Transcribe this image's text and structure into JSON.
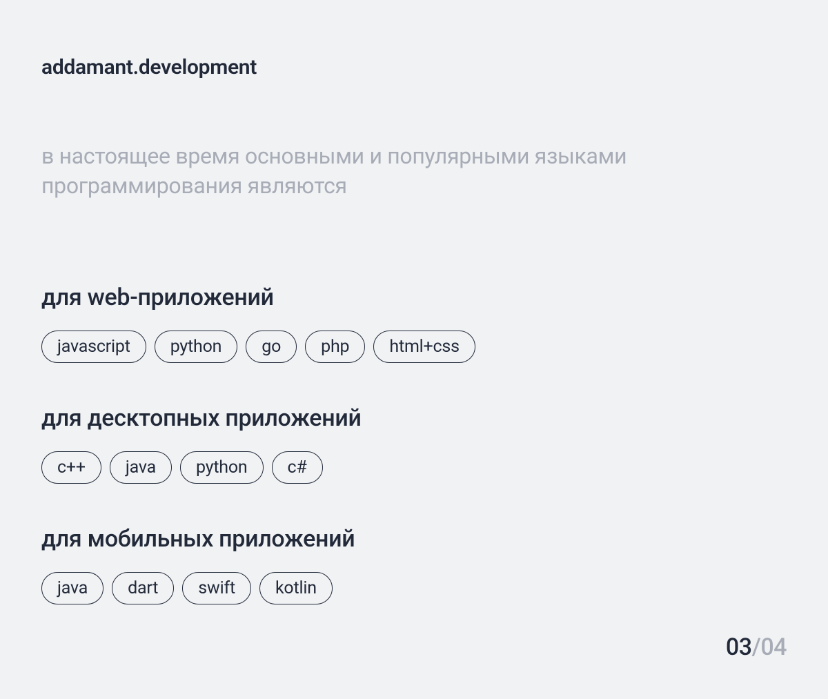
{
  "header": {
    "title": "addamant.development"
  },
  "subtitle": "в настоящее время основными и популярными языками программирования являются",
  "categories": [
    {
      "title": "для web-приложений",
      "tags": [
        "javascript",
        "python",
        "go",
        "php",
        "html+css"
      ]
    },
    {
      "title": "для десктопных приложений",
      "tags": [
        "c++",
        "java",
        "python",
        "c#"
      ]
    },
    {
      "title": "для  мобильных приложений",
      "tags": [
        "java",
        "dart",
        "swift",
        "kotlin"
      ]
    }
  ],
  "pagination": {
    "current": "03",
    "separator": "/",
    "total": "04"
  }
}
